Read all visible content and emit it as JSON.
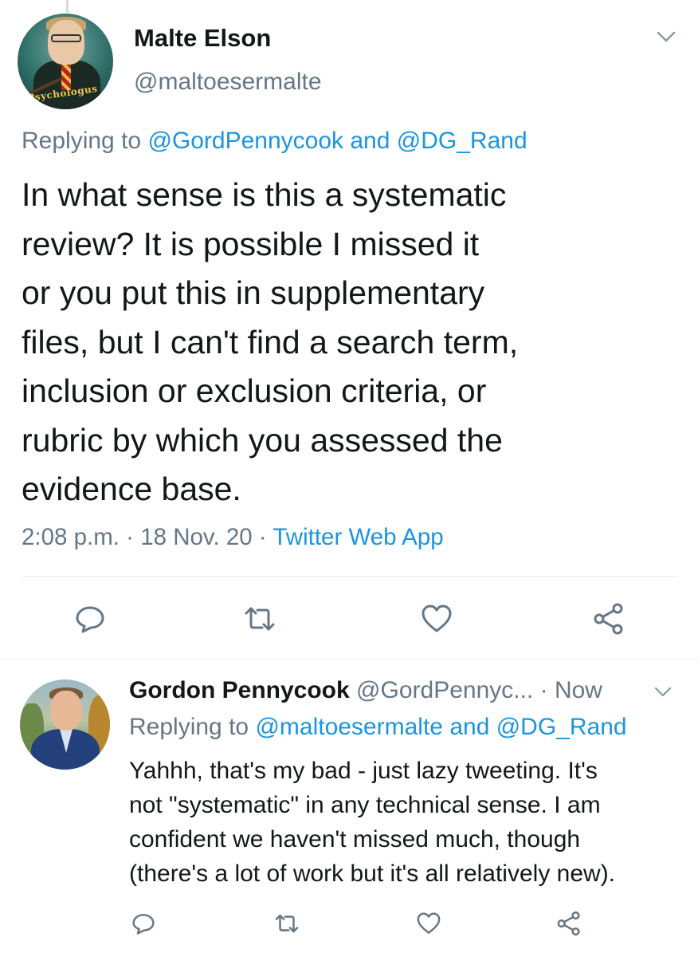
{
  "main_tweet": {
    "author_name": "Malte Elson",
    "author_handle": "@maltoesermalte",
    "avatar_banner_text": "Psychologus",
    "replying_prefix": "Replying to ",
    "replying_to_1": "@GordPennycook",
    "replying_joiner": " and ",
    "replying_to_2": "@DG_Rand",
    "text_lines": [
      "In what sense is this a systematic",
      "review? It is possible I missed it",
      "or you put this in supplementary",
      "files, but I can't find a search term,",
      "inclusion or exclusion criteria, or",
      "rubric by which you assessed the",
      "evidence base."
    ],
    "time": "2:08 p.m.",
    "separator": " · ",
    "date": "18 Nov. 20",
    "source": "Twitter Web App"
  },
  "reply_tweet": {
    "author_name": "Gordon Pennycook",
    "author_handle": "@GordPennyc...",
    "time_sep": " · ",
    "time": "Now",
    "replying_prefix": "Replying to ",
    "replying_to_1": "@maltoesermalte",
    "replying_joiner": " and ",
    "replying_to_2": "@DG_Rand",
    "text_lines": [
      "Yahhh, that's my bad - just lazy tweeting. It's",
      "not \"systematic\" in any technical sense. I am",
      "confident we haven't missed much, though",
      "(there's a lot of work but it's all relatively new)."
    ]
  },
  "icons": {
    "reply": "reply-icon",
    "retweet": "retweet-icon",
    "like": "heart-icon",
    "share": "share-icon",
    "more": "chevron-down-icon"
  },
  "colors": {
    "text": "#14171a",
    "secondary": "#657786",
    "link": "#1b95e0",
    "divider": "#e6ecf0"
  }
}
